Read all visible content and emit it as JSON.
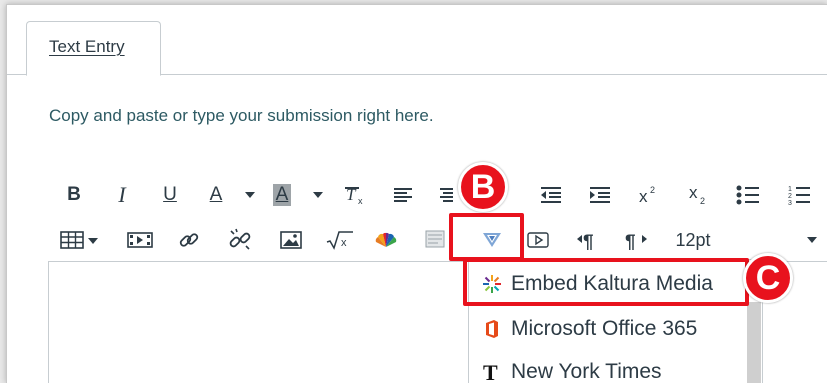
{
  "tab": {
    "label": "Text Entry"
  },
  "instructions": "Copy and paste or type your submission right here.",
  "toolbar": {
    "bold": "B",
    "italic": "I",
    "underline": "U",
    "font_color": "A",
    "bg_color": "A",
    "font_size": "12pt"
  },
  "annotations": {
    "b": "B",
    "c": "C"
  },
  "dropdown": {
    "items": [
      {
        "label": "Embed Kaltura Media",
        "icon": "kaltura-icon"
      },
      {
        "label": "Microsoft Office 365",
        "icon": "office-icon"
      },
      {
        "label": "New York Times",
        "icon": "nyt-icon"
      }
    ]
  },
  "colors": {
    "accent_red": "#e8121d",
    "text": "#2d3b45",
    "border": "#c7cdd1"
  }
}
